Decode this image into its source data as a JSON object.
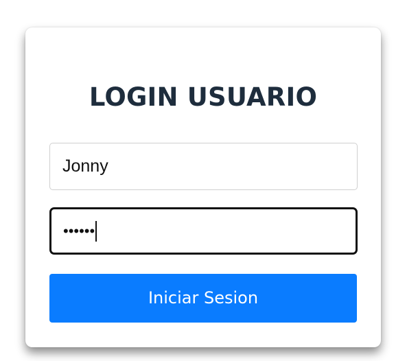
{
  "login": {
    "title": "LOGIN USUARIO",
    "username_value": "Jonny",
    "password_mask": "••••••",
    "submit_label": "Iniciar Sesion"
  },
  "colors": {
    "title": "#1e2d3d",
    "button": "#0a7cff",
    "button_text": "#ffffff"
  }
}
